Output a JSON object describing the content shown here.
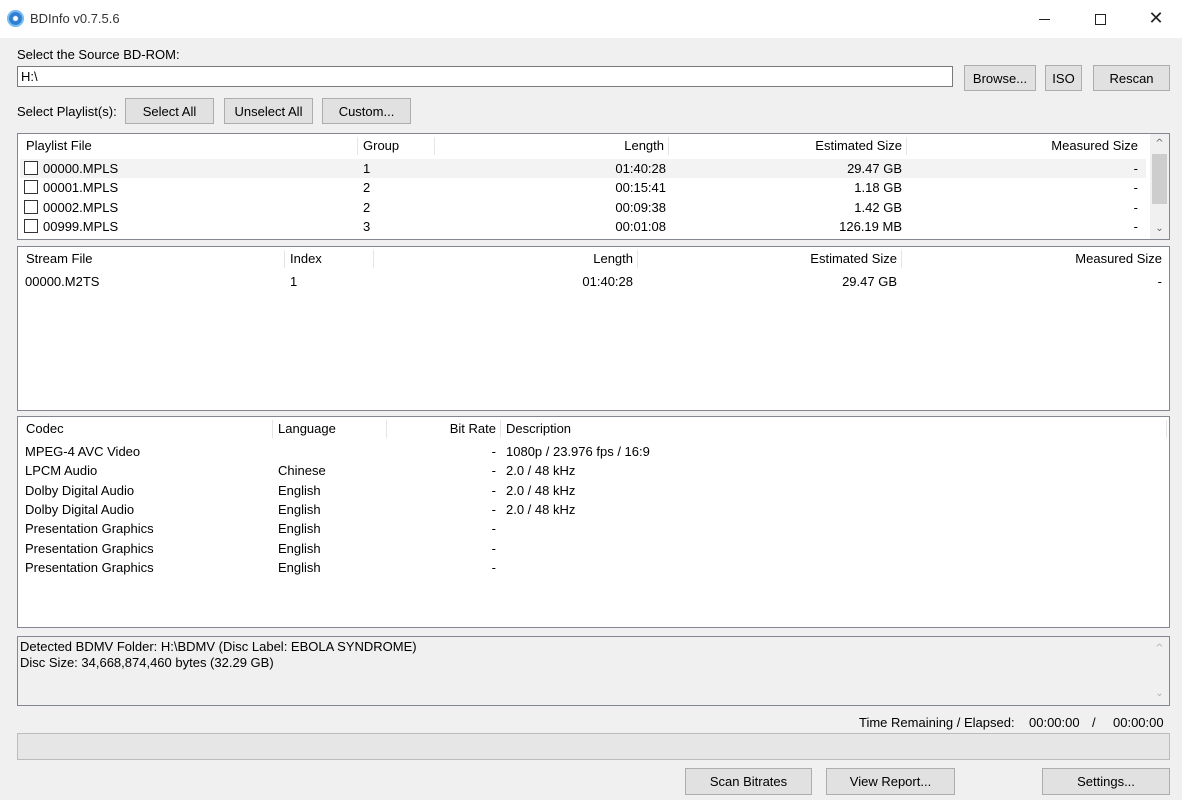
{
  "window": {
    "title": "BDInfo v0.7.5.6",
    "close_glyph": "✕"
  },
  "source": {
    "label": "Select the Source BD-ROM:",
    "path": "H:\\",
    "browse_label": "Browse...",
    "iso_label": "ISO",
    "rescan_label": "Rescan"
  },
  "playlist_select": {
    "label": "Select Playlist(s):",
    "select_all": "Select All",
    "unselect_all": "Unselect All",
    "custom": "Custom..."
  },
  "playlists": {
    "columns": [
      "Playlist File",
      "Group",
      "Length",
      "Estimated Size",
      "Measured Size"
    ],
    "rows": [
      {
        "file": "00000.MPLS",
        "group": "1",
        "length": "01:40:28",
        "estimated": "29.47 GB",
        "measured": "-"
      },
      {
        "file": "00001.MPLS",
        "group": "2",
        "length": "00:15:41",
        "estimated": "1.18 GB",
        "measured": "-"
      },
      {
        "file": "00002.MPLS",
        "group": "2",
        "length": "00:09:38",
        "estimated": "1.42 GB",
        "measured": "-"
      },
      {
        "file": "00999.MPLS",
        "group": "3",
        "length": "00:01:08",
        "estimated": "126.19 MB",
        "measured": "-"
      }
    ],
    "scroll_up": "^",
    "scroll_down": "⌄"
  },
  "streams": {
    "columns": [
      "Stream File",
      "Index",
      "Length",
      "Estimated Size",
      "Measured Size"
    ],
    "rows": [
      {
        "file": "00000.M2TS",
        "index": "1",
        "length": "01:40:28",
        "estimated": "29.47 GB",
        "measured": "-"
      }
    ]
  },
  "codecs": {
    "columns": [
      "Codec",
      "Language",
      "Bit Rate",
      "Description"
    ],
    "rows": [
      {
        "codec": "MPEG-4 AVC Video",
        "language": "",
        "bitrate": "-",
        "description": "1080p / 23.976 fps / 16:9"
      },
      {
        "codec": "LPCM Audio",
        "language": "Chinese",
        "bitrate": "-",
        "description": "2.0 / 48 kHz"
      },
      {
        "codec": "Dolby Digital Audio",
        "language": "English",
        "bitrate": "-",
        "description": "2.0 / 48 kHz"
      },
      {
        "codec": "Dolby Digital Audio",
        "language": "English",
        "bitrate": "-",
        "description": "2.0 / 48 kHz"
      },
      {
        "codec": "Presentation Graphics",
        "language": "English",
        "bitrate": "-",
        "description": ""
      },
      {
        "codec": "Presentation Graphics",
        "language": "English",
        "bitrate": "-",
        "description": ""
      },
      {
        "codec": "Presentation Graphics",
        "language": "English",
        "bitrate": "-",
        "description": ""
      }
    ]
  },
  "log": {
    "lines": [
      "Detected BDMV Folder: H:\\BDMV (Disc Label: EBOLA SYNDROME)",
      "Disc Size: 34,668,874,460 bytes (32.29 GB)"
    ]
  },
  "timer": {
    "label": "Time Remaining / Elapsed:",
    "remaining": "00:00:00",
    "separator": "/",
    "elapsed": "00:00:00"
  },
  "progress": {
    "value": 0
  },
  "footer": {
    "scan_bitrates": "Scan Bitrates",
    "view_report": "View Report...",
    "settings": "Settings..."
  }
}
